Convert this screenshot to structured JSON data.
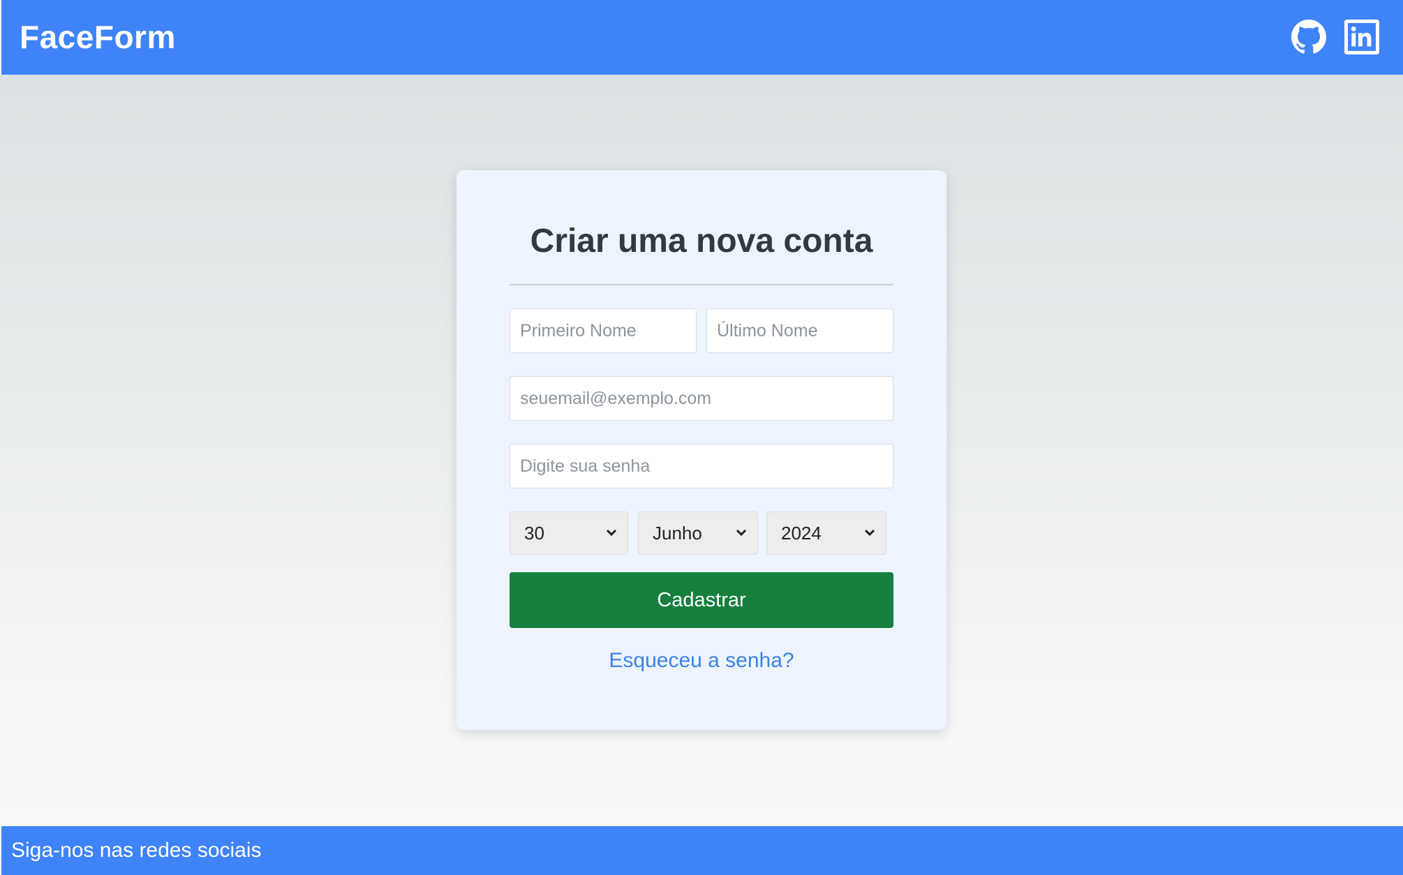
{
  "header": {
    "brand": "FaceForm",
    "social_icons": [
      "github-icon",
      "linkedin-icon"
    ]
  },
  "form": {
    "title": "Criar uma nova conta",
    "first_name_placeholder": "Primeiro Nome",
    "last_name_placeholder": "Último Nome",
    "email_placeholder": "seuemail@exemplo.com",
    "password_placeholder": "Digite sua senha",
    "birth_day": "30",
    "birth_month": "Junho",
    "birth_year": "2024",
    "submit_label": "Cadastrar",
    "forgot_link": "Esqueceu a senha?"
  },
  "footer": {
    "text": "Siga-nos nas redes sociais"
  },
  "colors": {
    "primary_blue": "#3f83f8",
    "submit_green": "#177f3e",
    "link_blue": "#3b82e6",
    "card_bg": "#eef4fe"
  }
}
